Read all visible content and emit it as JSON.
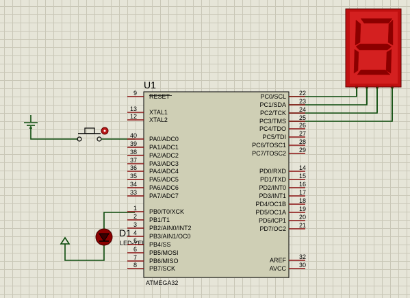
{
  "mcu": {
    "ref": "U1",
    "part": "ATMEGA32",
    "left_pins": [
      {
        "num": "9",
        "name": "RESET"
      },
      {
        "num": "13",
        "name": "XTAL1"
      },
      {
        "num": "12",
        "name": "XTAL2"
      },
      {
        "num": "40",
        "name": "PA0/ADC0"
      },
      {
        "num": "39",
        "name": "PA1/ADC1"
      },
      {
        "num": "38",
        "name": "PA2/ADC2"
      },
      {
        "num": "37",
        "name": "PA3/ADC3"
      },
      {
        "num": "36",
        "name": "PA4/ADC4"
      },
      {
        "num": "35",
        "name": "PA5/ADC5"
      },
      {
        "num": "34",
        "name": "PA6/ADC6"
      },
      {
        "num": "33",
        "name": "PA7/ADC7"
      },
      {
        "num": "1",
        "name": "PB0/T0/XCK"
      },
      {
        "num": "2",
        "name": "PB1/T1"
      },
      {
        "num": "3",
        "name": "PB2/AIN0/INT2"
      },
      {
        "num": "4",
        "name": "PB3/AIN1/OC0"
      },
      {
        "num": "5",
        "name": "PB4/SS"
      },
      {
        "num": "6",
        "name": "PB5/MOSI"
      },
      {
        "num": "7",
        "name": "PB6/MISO"
      },
      {
        "num": "8",
        "name": "PB7/SCK"
      }
    ],
    "right_pins": [
      {
        "num": "22",
        "name": "PC0/SCL"
      },
      {
        "num": "23",
        "name": "PC1/SDA"
      },
      {
        "num": "24",
        "name": "PC2/TCK"
      },
      {
        "num": "25",
        "name": "PC3/TMS"
      },
      {
        "num": "26",
        "name": "PC4/TDO"
      },
      {
        "num": "27",
        "name": "PC5/TDI"
      },
      {
        "num": "28",
        "name": "PC6/TOSC1"
      },
      {
        "num": "29",
        "name": "PC7/TOSC2"
      },
      {
        "num": "14",
        "name": "PD0/RXD"
      },
      {
        "num": "15",
        "name": "PD1/TXD"
      },
      {
        "num": "16",
        "name": "PD2/INT0"
      },
      {
        "num": "17",
        "name": "PD3/INT1"
      },
      {
        "num": "18",
        "name": "PD4/OC1B"
      },
      {
        "num": "19",
        "name": "PD5/OC1A"
      },
      {
        "num": "20",
        "name": "PD6/ICP1"
      },
      {
        "num": "21",
        "name": "PD7/OC2"
      },
      {
        "num": "32",
        "name": "AREF"
      },
      {
        "num": "30",
        "name": "AVCC"
      }
    ]
  },
  "led": {
    "ref": "D1",
    "value": "LED-YELLOW"
  },
  "display": {
    "digit": "8"
  },
  "colors": {
    "chip_body": "#cfcfb5",
    "pin_stub": "#8c1010",
    "wire": "#0a4a0a",
    "segment_on": "#8b0000",
    "display_frame": "#c01010",
    "led_body": "#8b0000"
  }
}
